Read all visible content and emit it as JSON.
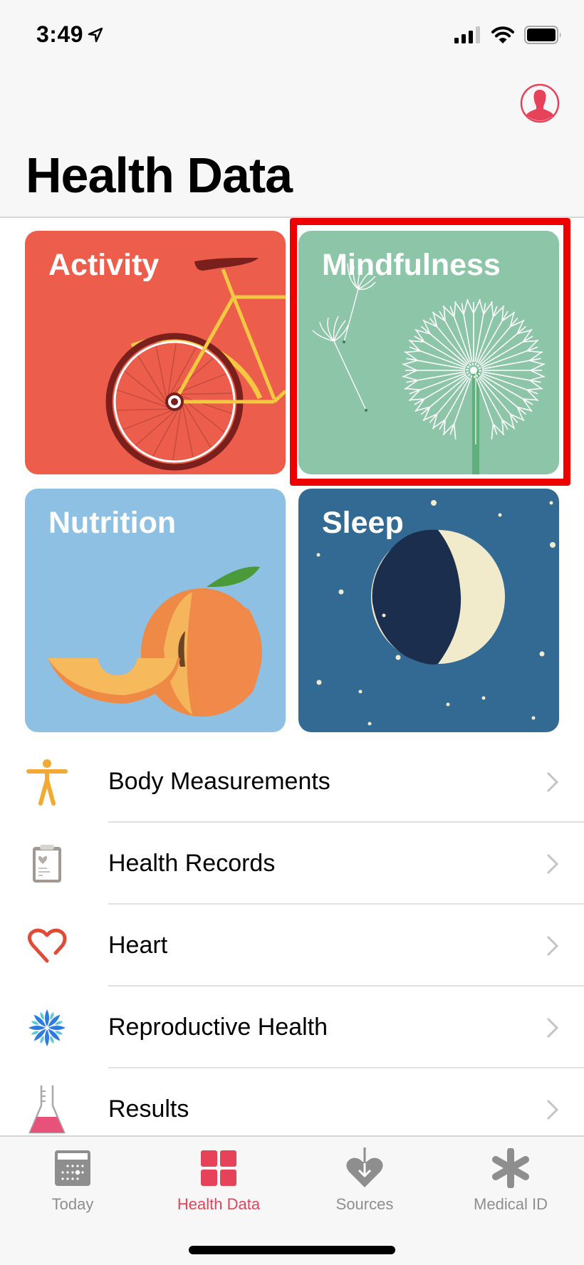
{
  "status_bar": {
    "time": "3:49",
    "icons": [
      "location-arrow-icon",
      "cellular-signal-icon",
      "wifi-icon",
      "battery-icon"
    ]
  },
  "header": {
    "title": "Health Data",
    "profile_icon": "profile-icon"
  },
  "tiles": [
    {
      "label": "Activity",
      "color": "#ec5e4b",
      "illustration": "bicycle"
    },
    {
      "label": "Mindfulness",
      "color": "#8cc5a7",
      "illustration": "dandelion",
      "highlighted": true
    },
    {
      "label": "Nutrition",
      "color": "#8ec0e3",
      "illustration": "peach"
    },
    {
      "label": "Sleep",
      "color": "#336a93",
      "illustration": "moon-and-stars"
    }
  ],
  "categories": [
    {
      "label": "Body Measurements",
      "icon": "body-figure-icon"
    },
    {
      "label": "Health Records",
      "icon": "clipboard-icon"
    },
    {
      "label": "Heart",
      "icon": "heart-icon"
    },
    {
      "label": "Reproductive Health",
      "icon": "flower-icon"
    },
    {
      "label": "Results",
      "icon": "flask-icon"
    }
  ],
  "tab_bar": {
    "tabs": [
      {
        "label": "Today",
        "icon": "calendar-icon",
        "active": false
      },
      {
        "label": "Health Data",
        "icon": "grid-icon",
        "active": true
      },
      {
        "label": "Sources",
        "icon": "heart-download-icon",
        "active": false
      },
      {
        "label": "Medical ID",
        "icon": "asterisk-icon",
        "active": false
      }
    ]
  },
  "colors": {
    "accent": "#e6435a",
    "highlight_box": "#ee0000",
    "inactive_tab": "#8e8e8e"
  }
}
